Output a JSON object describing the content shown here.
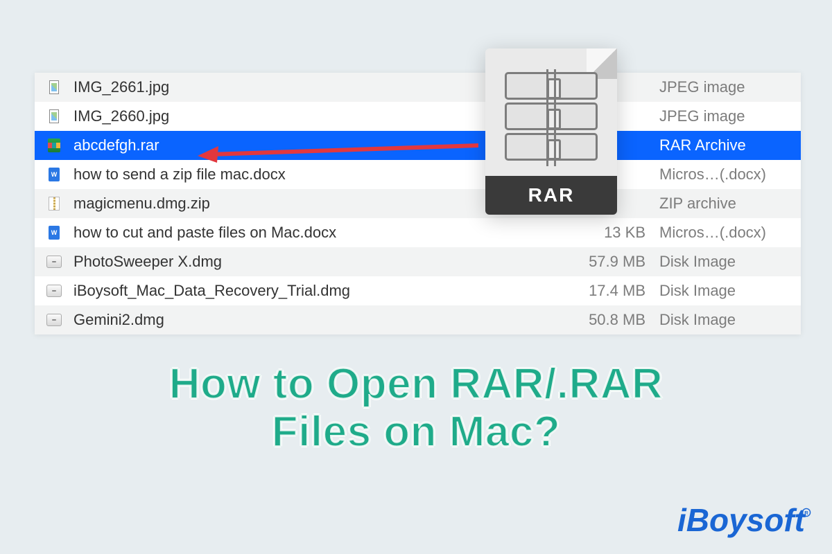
{
  "files": [
    {
      "name": "IMG_2661.jpg",
      "size": "",
      "kind": "JPEG image",
      "icon": "jpg",
      "alt": true,
      "selected": false
    },
    {
      "name": "IMG_2660.jpg",
      "size": "",
      "kind": "JPEG image",
      "icon": "jpg",
      "alt": false,
      "selected": false
    },
    {
      "name": "abcdefgh.rar",
      "size": "",
      "kind": "RAR Archive",
      "icon": "rar",
      "alt": false,
      "selected": true
    },
    {
      "name": "how to send a zip file mac.docx",
      "size": "",
      "kind": "Micros…(.docx)",
      "icon": "doc",
      "alt": false,
      "selected": false
    },
    {
      "name": "magicmenu.dmg.zip",
      "size": "",
      "kind": "ZIP archive",
      "icon": "zip",
      "alt": true,
      "selected": false
    },
    {
      "name": "how to cut and paste files on Mac.docx",
      "size": "13 KB",
      "kind": "Micros…(.docx)",
      "icon": "doc",
      "alt": false,
      "selected": false
    },
    {
      "name": "PhotoSweeper X.dmg",
      "size": "57.9 MB",
      "kind": "Disk Image",
      "icon": "dmg",
      "alt": true,
      "selected": false
    },
    {
      "name": "iBoysoft_Mac_Data_Recovery_Trial.dmg",
      "size": "17.4 MB",
      "kind": "Disk Image",
      "icon": "dmg",
      "alt": false,
      "selected": false
    },
    {
      "name": "Gemini2.dmg",
      "size": "50.8 MB",
      "kind": "Disk Image",
      "icon": "dmg",
      "alt": true,
      "selected": false
    }
  ],
  "rar_overlay_label": "RAR",
  "headline_line1": "How to Open RAR/.RAR",
  "headline_line2": "Files on Mac?",
  "brand_text": "iBoysoft"
}
